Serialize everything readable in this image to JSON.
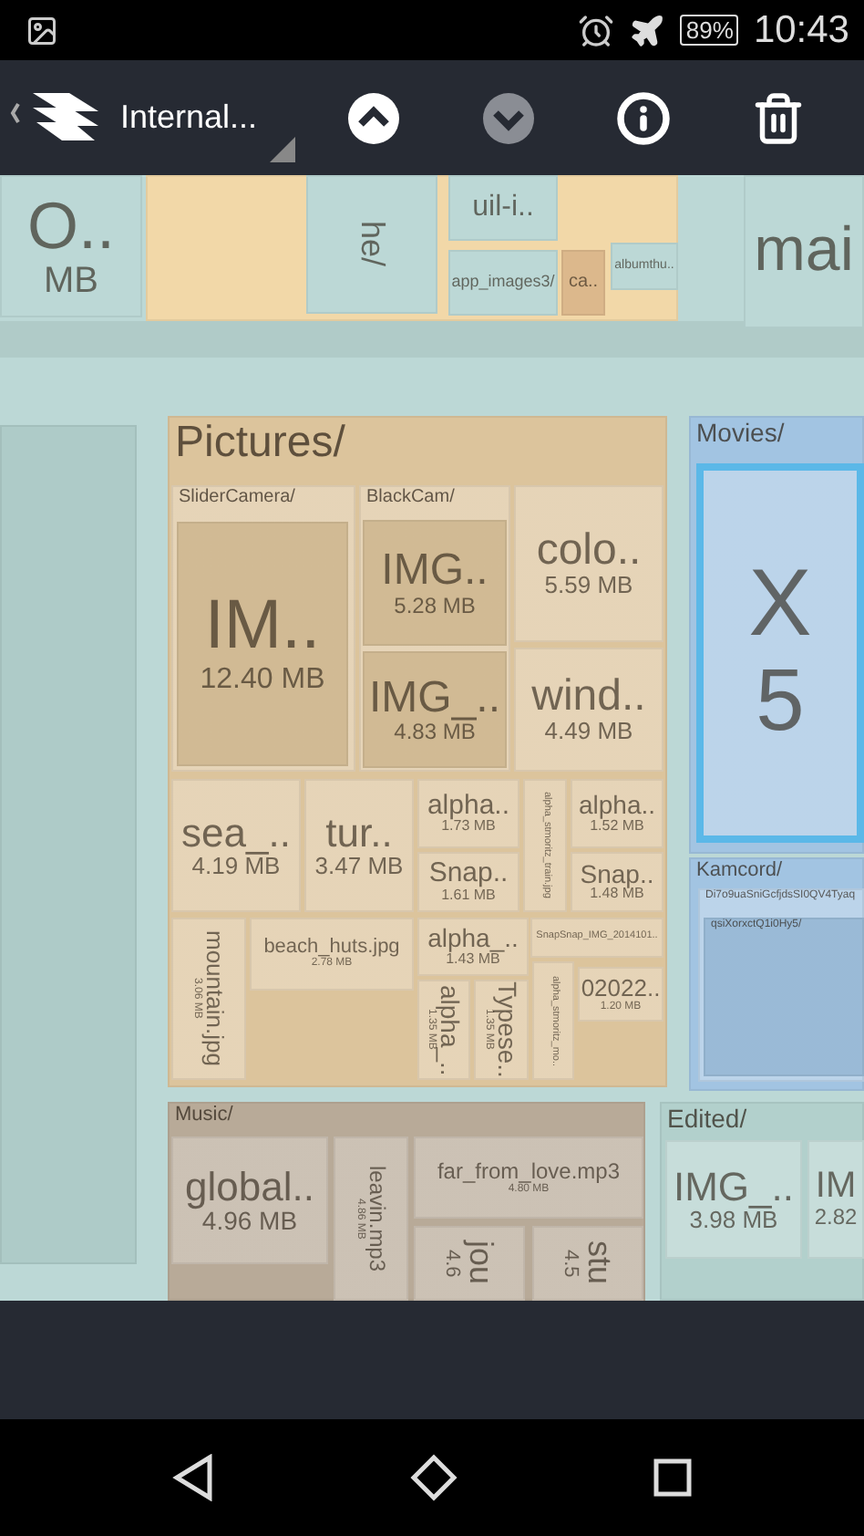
{
  "status_bar": {
    "time": "10:43",
    "battery": "89%"
  },
  "toolbar": {
    "storage": "Internal...",
    "buttons": [
      {
        "kind": "up",
        "disabled": false
      },
      {
        "kind": "down",
        "disabled": true
      },
      {
        "kind": "info",
        "disabled": false
      },
      {
        "kind": "delete",
        "disabled": false
      }
    ]
  },
  "treemap": {
    "items": [
      {
        "kind": "file",
        "label": "O..",
        "size": "MB",
        "color": "#bcd8d6",
        "selected": false
      },
      {
        "kind": "folder",
        "color": "#f2d8a8",
        "selected": false,
        "children": [
          {
            "kind": "file",
            "label": "he/",
            "rotated": true,
            "color": "#bcd8d6",
            "selected": false
          },
          {
            "kind": "file",
            "label": "uil-i..",
            "color": "#bcd8d6",
            "selected": false
          },
          {
            "kind": "file",
            "label": "app_images3/",
            "color": "#bcd8d6",
            "selected": false
          },
          {
            "kind": "file",
            "label": "ca..",
            "color": "#dcb88c",
            "selected": false
          },
          {
            "kind": "file",
            "label": "albumthu..",
            "color": "#bcd8d6",
            "selected": false
          }
        ]
      },
      {
        "kind": "file",
        "label": "mai",
        "color": "#bcd8d6",
        "selected": false
      },
      {
        "kind": "folder",
        "label": "Pictures/",
        "color": "#dcc49c",
        "selected": false,
        "children": [
          {
            "kind": "folder",
            "label": "SliderCamera/",
            "selected": false,
            "children": [
              {
                "kind": "file",
                "label": "IM..",
                "size": "12.40 MB",
                "selected": false
              }
            ]
          },
          {
            "kind": "folder",
            "label": "BlackCam/",
            "selected": false,
            "children": [
              {
                "kind": "file",
                "label": "IMG..",
                "size": "5.28 MB",
                "selected": false
              },
              {
                "kind": "file",
                "label": "IMG_..",
                "size": "4.83 MB",
                "selected": false
              }
            ]
          },
          {
            "kind": "file",
            "label": "colo..",
            "size": "5.59 MB",
            "selected": false
          },
          {
            "kind": "file",
            "label": "wind..",
            "size": "4.49 MB",
            "selected": false
          },
          {
            "kind": "file",
            "label": "sea_..",
            "size": "4.19 MB",
            "selected": false
          },
          {
            "kind": "file",
            "label": "tur..",
            "size": "3.47 MB",
            "selected": false
          },
          {
            "kind": "file",
            "label": "alpha..",
            "size": "1.73 MB",
            "selected": false
          },
          {
            "kind": "file",
            "label": "Snap..",
            "size": "1.61 MB",
            "selected": false
          },
          {
            "kind": "file",
            "label": "alpha_stmoritz_train.jpg",
            "rotated": true,
            "selected": false
          },
          {
            "kind": "file",
            "label": "alpha..",
            "size": "1.52 MB",
            "selected": false
          },
          {
            "kind": "file",
            "label": "Snap..",
            "size": "1.48 MB",
            "selected": false
          },
          {
            "kind": "file",
            "label": "mountain.jpg",
            "size": "3.06 MB",
            "rotated": true,
            "selected": false
          },
          {
            "kind": "file",
            "label": "beach_huts.jpg",
            "size": "2.78 MB",
            "selected": false
          },
          {
            "kind": "file",
            "label": "alpha_..",
            "size": "1.43 MB",
            "selected": false
          },
          {
            "kind": "file",
            "label": "SnapSnap_IMG_2014101..",
            "selected": false
          },
          {
            "kind": "file",
            "label": "alpha_..",
            "size": "1.35 MB",
            "rotated": true,
            "selected": false
          },
          {
            "kind": "file",
            "label": "Typese..",
            "size": "1.35 MB",
            "rotated": true,
            "selected": false
          },
          {
            "kind": "file",
            "label": "alpha_stmoritz_mo..",
            "rotated": true,
            "selected": false
          },
          {
            "kind": "file",
            "label": "02022..",
            "size": "1.20 MB",
            "selected": false
          }
        ]
      },
      {
        "kind": "folder",
        "label": "Movies/",
        "color": "#a2c4e2",
        "selected": false,
        "children": [
          {
            "kind": "file",
            "label": "X",
            "size": "5",
            "selected": true
          }
        ]
      },
      {
        "kind": "folder",
        "label": "Kamcord/",
        "color": "#a2c4e2",
        "selected": false,
        "children": [
          {
            "kind": "folder",
            "label": "Di7o9uaSniGcfjdsSI0QV4Tyaq",
            "selected": false,
            "children": [
              {
                "kind": "folder",
                "label": "qsiXorxctQ1i0Hy5/",
                "selected": false
              }
            ]
          }
        ]
      },
      {
        "kind": "folder",
        "label": "Music/",
        "color": "#b8aa98",
        "selected": false,
        "children": [
          {
            "kind": "file",
            "label": "global..",
            "size": "4.96 MB",
            "selected": false
          },
          {
            "kind": "file",
            "label": "leavin.mp3",
            "size": "4.86 MB",
            "rotated": true,
            "selected": false
          },
          {
            "kind": "file",
            "label": "far_from_love.mp3",
            "size": "4.80 MB",
            "selected": false
          },
          {
            "kind": "file",
            "label": "jou",
            "size": "4.6",
            "rotated": true,
            "selected": false
          },
          {
            "kind": "file",
            "label": "stu",
            "size": "4.5",
            "rotated": true,
            "selected": false
          }
        ]
      },
      {
        "kind": "folder",
        "label": "Edited/",
        "color": "#b2d0cc",
        "selected": false,
        "children": [
          {
            "kind": "file",
            "label": "IMG_..",
            "size": "3.98 MB",
            "selected": false
          },
          {
            "kind": "file",
            "label": "IM",
            "size": "2.82",
            "selected": false
          }
        ]
      },
      {
        "kind": "folder",
        "color": "#aecbc8",
        "selected": false
      }
    ]
  }
}
